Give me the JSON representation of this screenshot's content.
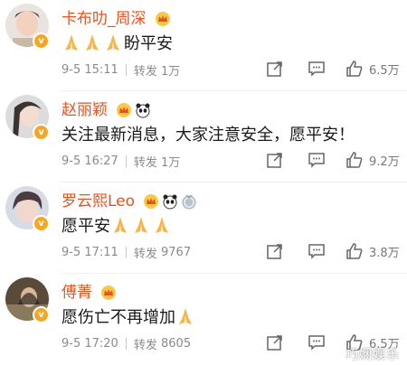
{
  "comments": [
    {
      "name": "卡布叻_周深",
      "badges": [
        "crown-badge-icon"
      ],
      "text_prefix_icons": [
        "pray-icon",
        "pray-icon",
        "pray-icon"
      ],
      "text": "盼平安",
      "text_suffix_icons": [],
      "date": "9-5 15:11",
      "repost_label": "转发",
      "repost_count": "1万",
      "likes": "6.5万"
    },
    {
      "name": "赵丽颖",
      "badges": [
        "crown-badge-icon",
        "panda-badge-icon"
      ],
      "text_prefix_icons": [],
      "text": "关注最新消息，大家注意安全，愿平安！",
      "text_suffix_icons": [],
      "date": "9-5 16:27",
      "repost_label": "转发",
      "repost_count": "1万",
      "likes": "9.2万"
    },
    {
      "name": "罗云熙Leo",
      "badges": [
        "crown-badge-icon",
        "panda-badge-icon",
        "medal-badge-icon"
      ],
      "text_prefix_icons": [],
      "text": "愿平安",
      "text_suffix_icons": [
        "pray-icon",
        "pray-icon",
        "pray-icon"
      ],
      "date": "9-5 17:11",
      "repost_label": "转发",
      "repost_count": "9767",
      "likes": "3.8万"
    },
    {
      "name": "傅菁",
      "badges": [
        "crown-badge-icon"
      ],
      "text_prefix_icons": [],
      "text": "愿伤亡不再增加",
      "text_suffix_icons": [
        "pray-icon"
      ],
      "date": "9-5 17:20",
      "repost_label": "转发",
      "repost_count": "8605",
      "likes": "6.5万"
    }
  ],
  "watermark": "巧娴娱乐",
  "colors": {
    "name": "#e8521e",
    "meta": "#8a8a8a",
    "badge": "#f5a623"
  }
}
